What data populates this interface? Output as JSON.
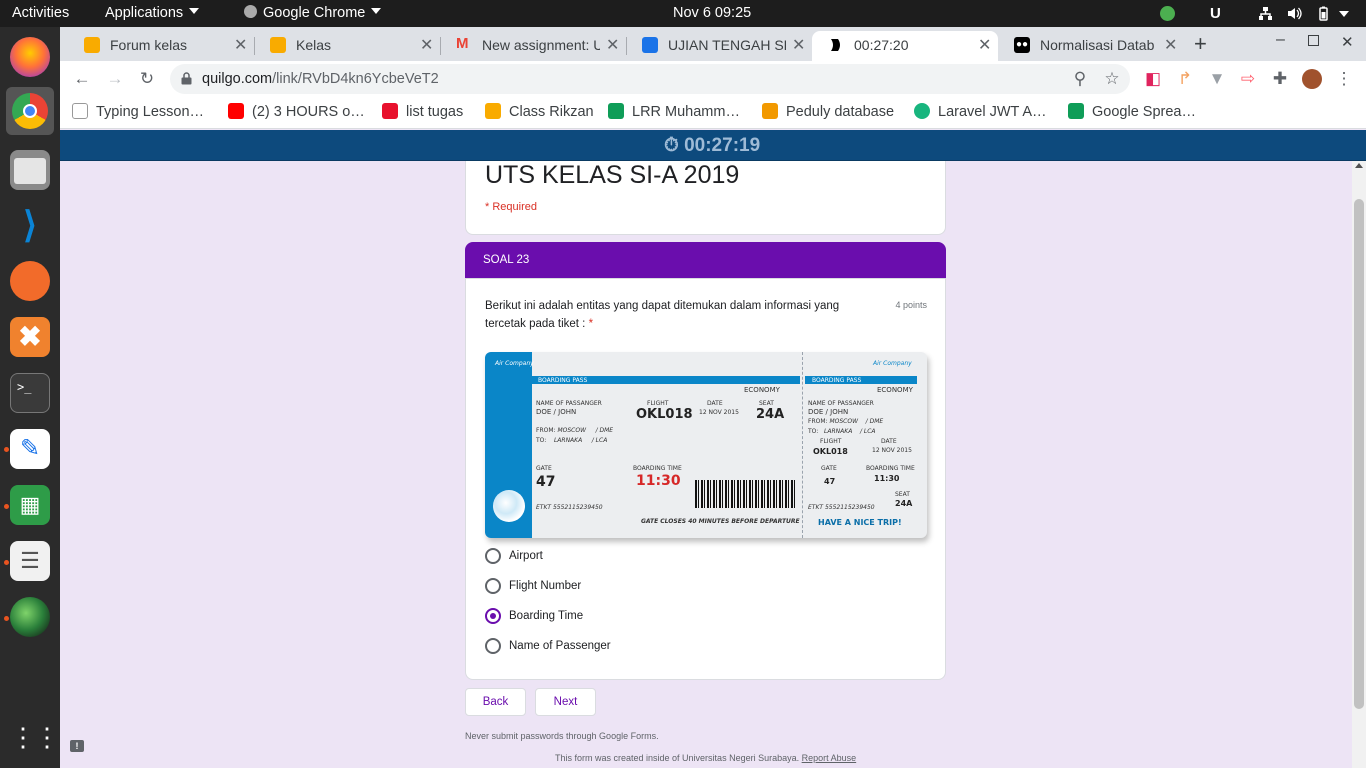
{
  "topbar": {
    "activities": "Activities",
    "applications": "Applications",
    "chrome_menu": "Google Chrome",
    "clock": "Nov 6  09:25"
  },
  "tabs": [
    {
      "title": "Forum kelas",
      "favicon_color": "#f9ab00"
    },
    {
      "title": "Kelas",
      "favicon_color": "#f9ab00"
    },
    {
      "title": "New assignment: U",
      "favicon_color": "#ea4335"
    },
    {
      "title": "UJIAN TENGAH SEI",
      "favicon_color": "#1a73e8"
    },
    {
      "title": "00:27:20",
      "favicon_color": "#000000",
      "active": true
    },
    {
      "title": "Normalisasi Datab",
      "favicon_color": "#000000"
    }
  ],
  "omnibox": {
    "host": "quilgo.com",
    "path": "/link/RVbD4kn6YcbeVeT2"
  },
  "bookmarks": [
    {
      "label": "Typing Lesson…",
      "color": "#ffffff"
    },
    {
      "label": "(2) 3 HOURS o…",
      "color": "#ff0000"
    },
    {
      "label": "list tugas",
      "color": "#e8112d"
    },
    {
      "label": "Class Rikzan",
      "color": "#f9ab00"
    },
    {
      "label": "LRR Muhamm…",
      "color": "#0f9d58"
    },
    {
      "label": "Peduly database",
      "color": "#f29900"
    },
    {
      "label": "Laravel JWT A…",
      "color": "#18b57e"
    },
    {
      "label": "Google Sprea…",
      "color": "#0f9d58"
    }
  ],
  "timer": "⏱ 00:27:19",
  "form": {
    "title": "UTS KELAS SI-A 2019",
    "required_note": "* Required",
    "section": "SOAL 23",
    "question": "Berikut ini adalah entitas yang dapat ditemukan dalam informasi yang tercetak pada tiket :",
    "question_star": "*",
    "points": "4 points",
    "options": [
      {
        "label": "Airport",
        "selected": false
      },
      {
        "label": "Flight Number",
        "selected": false
      },
      {
        "label": "Boarding Time",
        "selected": true
      },
      {
        "label": "Name of Passenger",
        "selected": false
      }
    ],
    "back": "Back",
    "next": "Next",
    "footer_note": "Never submit passwords through Google Forms.",
    "footer_created": "This form was created inside of Universitas Negeri Surabaya.",
    "report": "Report Abuse"
  },
  "ticket": {
    "header": "BOARDING PASS",
    "class": "ECONOMY",
    "name_label": "NAME OF PASSANGER",
    "name": "DOE / JOHN",
    "flight_label": "FLIGHT",
    "flight": "OKL018",
    "date_label": "DATE",
    "date": "12 NOV 2015",
    "seat_label": "SEAT",
    "seat": "24A",
    "from_label": "FROM:",
    "from": "MOSCOW",
    "from_code": "/ DME",
    "to_label": "TO:",
    "to": "LARNAKA",
    "to_code": "/ LCA",
    "gate_label": "GATE",
    "gate": "47",
    "boarding_label": "BOARDING TIME",
    "boarding": "11:30",
    "etkt": "ETKT 5552115239450",
    "gate_note": "GATE CLOSES 40 MINUTES BEFORE DEPARTURE",
    "nice_trip": "HAVE A NICE TRIP!",
    "logo": "Air Company"
  },
  "colors": {
    "accent": "#6a0dad",
    "timer_bar": "#0d4a7d",
    "page_bg": "#ede4f5"
  }
}
